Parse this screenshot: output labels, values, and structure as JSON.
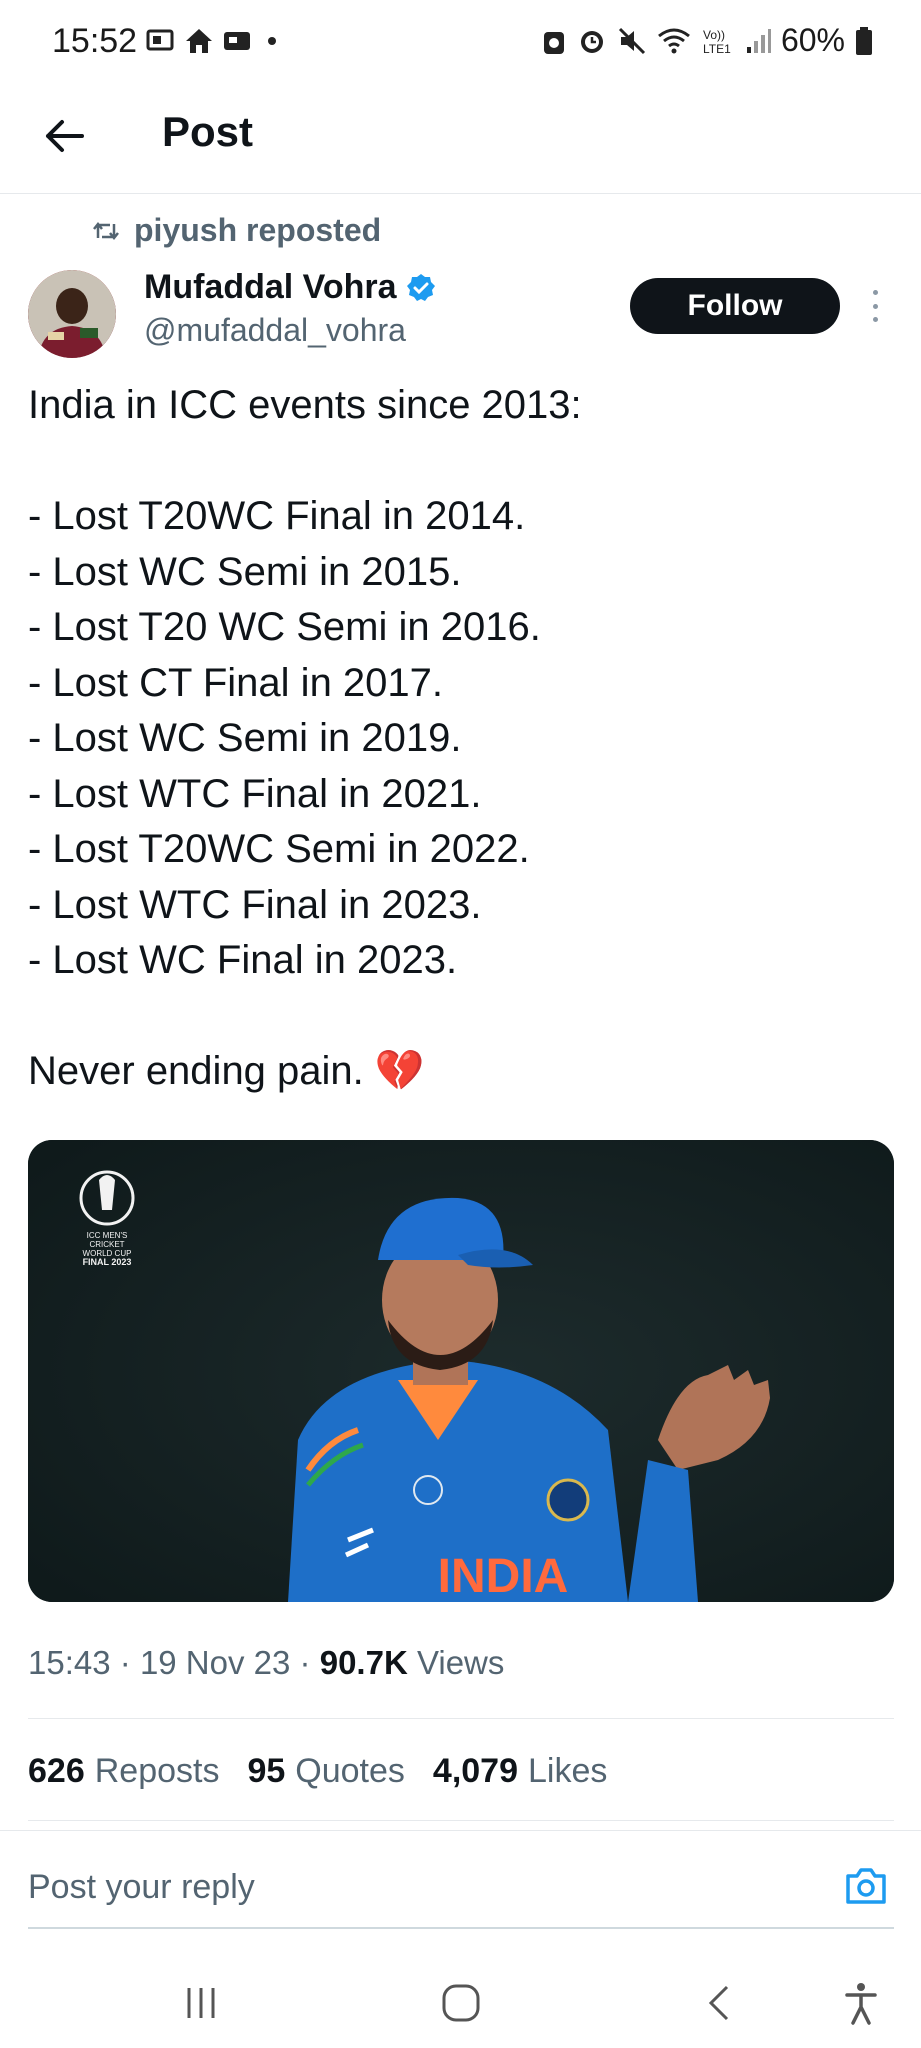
{
  "status_bar": {
    "time": "15:52",
    "battery": "60%"
  },
  "header": {
    "title": "Post"
  },
  "repost": {
    "text": "piyush reposted"
  },
  "author": {
    "name": "Mufaddal Vohra",
    "handle": "@mufaddal_vohra",
    "verified": true
  },
  "follow_label": "Follow",
  "tweet": {
    "lines": [
      "India in ICC events since 2013:",
      "",
      "- Lost T20WC Final in 2014.",
      "- Lost WC Semi in 2015.",
      "- Lost T20 WC Semi in 2016.",
      "- Lost CT Final in 2017.",
      "- Lost WC Semi in 2019.",
      "- Lost WTC Final in 2021.",
      "- Lost T20WC Semi in 2022.",
      "- Lost WTC Final in 2023.",
      "- Lost WC Final in 2023.",
      "",
      "Never ending pain. 💔"
    ]
  },
  "media": {
    "logo_lines": [
      "ICC MEN'S",
      "CRICKET",
      "WORLD CUP",
      "FINAL 2023"
    ],
    "jersey_text": "INDIA"
  },
  "meta": {
    "time": "15:43",
    "date": "19 Nov 23",
    "views_count": "90.7K",
    "views_label": "Views"
  },
  "stats": {
    "reposts_count": "626",
    "reposts_label": "Reposts",
    "quotes_count": "95",
    "quotes_label": "Quotes",
    "likes_count": "4,079",
    "likes_label": "Likes"
  },
  "reply": {
    "placeholder": "Post your reply"
  },
  "colors": {
    "accent": "#1d9bf0",
    "text": "#0f1419",
    "secondary": "#536471"
  }
}
